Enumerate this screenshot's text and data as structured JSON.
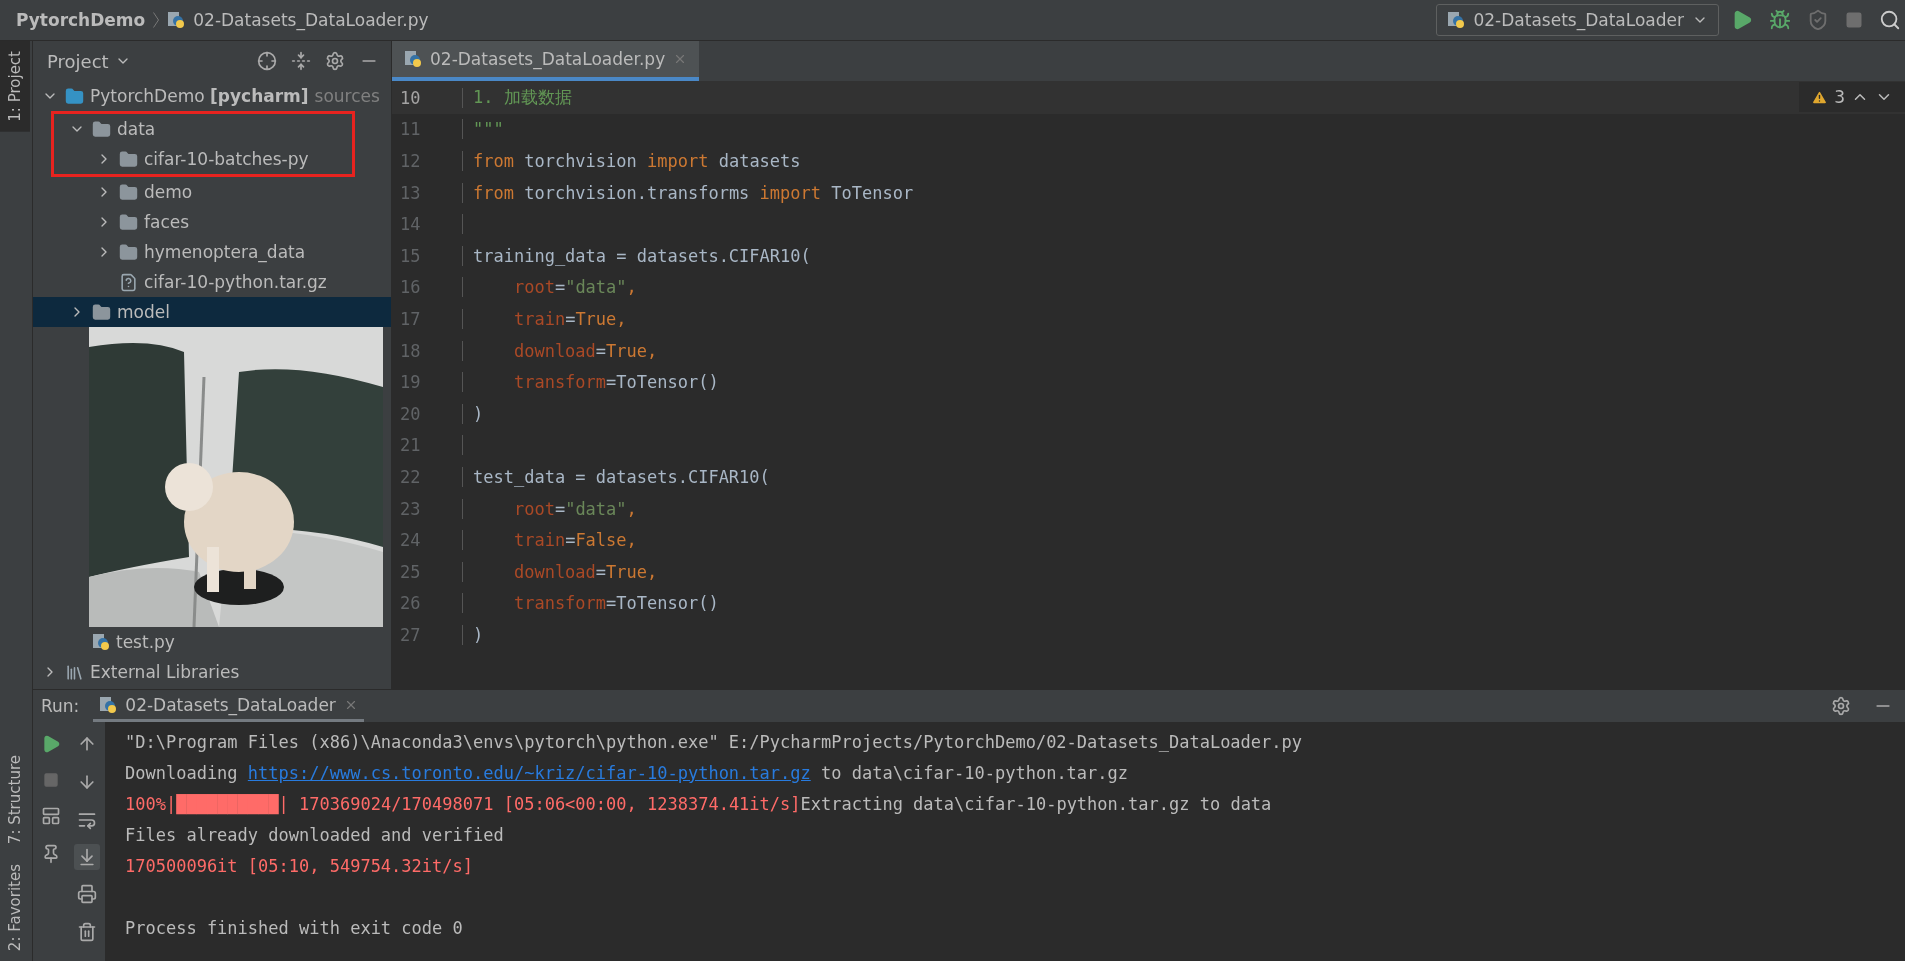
{
  "title_bar": {
    "breadcrumbs": [
      "PytorchDemo",
      "02-Datasets_DataLoader.py"
    ],
    "run_config": "02-Datasets_DataLoader"
  },
  "side_strip": {
    "top": [
      "1: Project"
    ],
    "bottom": [
      "7: Structure",
      "2: Favorites"
    ]
  },
  "project_panel": {
    "title": "Project",
    "tree": [
      {
        "label": "PytorchDemo **[pycharm]**",
        "suffix": "sources",
        "kind": "module",
        "expanded": true,
        "selected": false,
        "highlighted": false,
        "children": [
          {
            "label": "data",
            "kind": "folder",
            "expanded": true,
            "selected": false,
            "highlighted": true,
            "children": [
              {
                "label": "cifar-10-batches-py",
                "kind": "folder",
                "expanded": false,
                "selected": false,
                "highlighted": true
              },
              {
                "label": "demo",
                "kind": "folder",
                "expanded": false,
                "selected": false,
                "highlighted": false
              },
              {
                "label": "faces",
                "kind": "folder",
                "expanded": false,
                "selected": false,
                "highlighted": false
              },
              {
                "label": "hymenoptera_data",
                "kind": "folder",
                "expanded": false,
                "selected": false,
                "highlighted": false
              },
              {
                "label": "cifar-10-python.tar.gz",
                "kind": "archive",
                "selected": false,
                "highlighted": false
              }
            ]
          },
          {
            "label": "model",
            "kind": "folder",
            "expanded": false,
            "selected": true,
            "highlighted": false
          },
          {
            "kind": "picture"
          },
          {
            "label": "test.py",
            "kind": "python",
            "selected": false,
            "highlighted": false
          }
        ]
      },
      {
        "label": "External Libraries",
        "kind": "library",
        "expanded": false,
        "selected": false,
        "highlighted": false
      }
    ]
  },
  "editor": {
    "tabs": [
      {
        "label": "02-Datasets_DataLoader.py",
        "selected": true
      }
    ],
    "warnings": "3",
    "lines": [
      {
        "number": "10",
        "current": true,
        "tokens": [
          {
            "kind": "comment",
            "text": "1. 加载数据"
          }
        ]
      },
      {
        "number": "11",
        "current": false,
        "tokens": [
          {
            "kind": "comment",
            "text": "\"\"\""
          }
        ]
      },
      {
        "number": "12",
        "current": false,
        "tokens": [
          {
            "kind": "keyword",
            "text": "from "
          },
          {
            "kind": "plain",
            "text": "torchvision "
          },
          {
            "kind": "keyword",
            "text": "import "
          },
          {
            "kind": "plain",
            "text": "datasets"
          }
        ]
      },
      {
        "number": "13",
        "current": false,
        "tokens": [
          {
            "kind": "keyword",
            "text": "from "
          },
          {
            "kind": "plain",
            "text": "torchvision.transforms "
          },
          {
            "kind": "keyword",
            "text": "import "
          },
          {
            "kind": "plain",
            "text": "ToTensor"
          }
        ]
      },
      {
        "number": "14",
        "current": false
      },
      {
        "number": "15",
        "current": false,
        "tokens": [
          {
            "kind": "plain",
            "text": "training_data = datasets.CIFAR10("
          }
        ]
      },
      {
        "number": "16",
        "current": false,
        "indent": true,
        "tokens": [
          {
            "kind": "param",
            "text": "root"
          },
          {
            "kind": "plain",
            "text": "="
          },
          {
            "kind": "string",
            "text": "\"data\""
          },
          {
            "kind": "keyword",
            "text": ","
          }
        ]
      },
      {
        "number": "17",
        "current": false,
        "indent": true,
        "tokens": [
          {
            "kind": "param",
            "text": "train"
          },
          {
            "kind": "plain",
            "text": "="
          },
          {
            "kind": "keyword",
            "text": "True,"
          }
        ]
      },
      {
        "number": "18",
        "current": false,
        "indent": true,
        "tokens": [
          {
            "kind": "param",
            "text": "download"
          },
          {
            "kind": "plain",
            "text": "="
          },
          {
            "kind": "keyword",
            "text": "True,"
          }
        ]
      },
      {
        "number": "19",
        "current": false,
        "indent": true,
        "tokens": [
          {
            "kind": "param",
            "text": "transform"
          },
          {
            "kind": "plain",
            "text": "=ToTensor()"
          }
        ]
      },
      {
        "number": "20",
        "current": false,
        "tokens": [
          {
            "kind": "plain",
            "text": ")"
          }
        ]
      },
      {
        "number": "21",
        "current": false
      },
      {
        "number": "22",
        "current": false,
        "tokens": [
          {
            "kind": "plain",
            "text": "test_data = datasets.CIFAR10("
          }
        ]
      },
      {
        "number": "23",
        "current": false,
        "indent": true,
        "tokens": [
          {
            "kind": "param",
            "text": "root"
          },
          {
            "kind": "plain",
            "text": "="
          },
          {
            "kind": "string",
            "text": "\"data\""
          },
          {
            "kind": "keyword",
            "text": ","
          }
        ]
      },
      {
        "number": "24",
        "current": false,
        "indent": true,
        "tokens": [
          {
            "kind": "param",
            "text": "train"
          },
          {
            "kind": "plain",
            "text": "="
          },
          {
            "kind": "keyword",
            "text": "False,"
          }
        ]
      },
      {
        "number": "25",
        "current": false,
        "indent": true,
        "tokens": [
          {
            "kind": "param",
            "text": "download"
          },
          {
            "kind": "plain",
            "text": "="
          },
          {
            "kind": "keyword",
            "text": "True,"
          }
        ]
      },
      {
        "number": "26",
        "current": false,
        "indent": true,
        "tokens": [
          {
            "kind": "param",
            "text": "transform"
          },
          {
            "kind": "plain",
            "text": "=ToTensor()"
          }
        ]
      },
      {
        "number": "27",
        "current": false,
        "tokens": [
          {
            "kind": "plain",
            "text": ")"
          }
        ]
      }
    ]
  },
  "run_panel": {
    "label": "Run:",
    "tabs": [
      {
        "label": "02-Datasets_DataLoader",
        "selected": true
      }
    ],
    "output": [
      {
        "tokens": [
          {
            "kind": "plain",
            "text": "\"D:\\Program Files (x86)\\Anaconda3\\envs\\pytorch\\python.exe\" E:/PycharmProjects/PytorchDemo/02-Datasets_DataLoader.py"
          }
        ]
      },
      {
        "tokens": [
          {
            "kind": "plain",
            "text": "Downloading "
          },
          {
            "kind": "link",
            "text": "https://www.cs.toronto.edu/~kriz/cifar-10-python.tar.gz"
          },
          {
            "kind": "plain",
            "text": " to data\\cifar-10-python.tar.gz"
          }
        ]
      },
      {
        "tokens": [
          {
            "kind": "error",
            "text": "100%|"
          },
          {
            "kind": "bar",
            "text": "██████████"
          },
          {
            "kind": "error",
            "text": "| 170369024/170498071 [05:06<00:00, 1238374.41it/s]"
          },
          {
            "kind": "plain",
            "text": "Extracting data\\cifar-10-python.tar.gz to data"
          }
        ]
      },
      {
        "tokens": [
          {
            "kind": "plain",
            "text": "Files already downloaded and verified"
          }
        ]
      },
      {
        "tokens": [
          {
            "kind": "error",
            "text": "170500096it [05:10, 549754.32it/s]"
          }
        ]
      },
      {
        "gap_before": true,
        "tokens": [
          {
            "kind": "plain",
            "text": "Process finished with exit code 0"
          }
        ]
      }
    ]
  }
}
